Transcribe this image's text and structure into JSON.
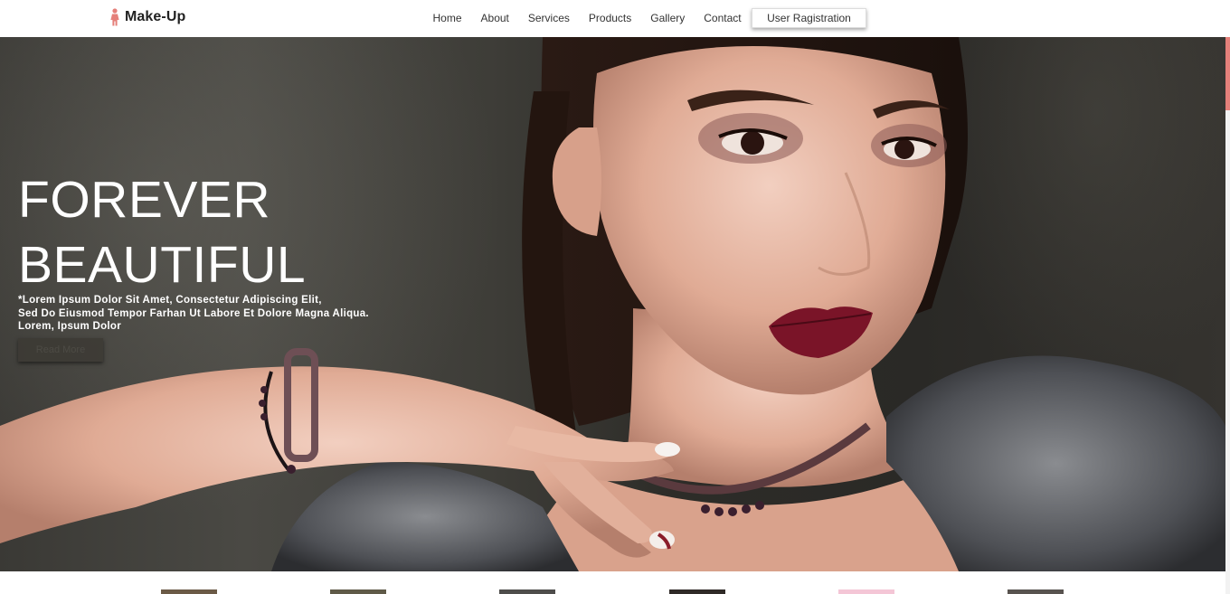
{
  "brand": {
    "name": "Make-Up",
    "icon": "woman-icon",
    "icon_color": "#e5807a"
  },
  "nav": {
    "links": [
      "Home",
      "About",
      "Services",
      "Products",
      "Gallery",
      "Contact"
    ],
    "register_label": "User Ragistration"
  },
  "hero": {
    "title_line1": "FOREVER",
    "title_line2": "BEAUTIFUL",
    "desc_line1": "*Lorem Ipsum Dolor Sit Amet, Consectetur Adipiscing Elit,",
    "desc_line2": "Sed Do Eiusmod Tempor Farhan Ut Labore Et Dolore Magna Aliqua.",
    "desc_line3": "Lorem, Ipsum Dolor",
    "button_label": "Read More",
    "image_subject": "woman with dark red lipstick"
  },
  "colors": {
    "accent": "#e5807a",
    "hero_text": "#ffffff"
  },
  "thumbnails": [
    {
      "color": "#6b5a46"
    },
    {
      "color": "#5f5a48"
    },
    {
      "color": "#4e4d4b"
    },
    {
      "color": "#2f2a27"
    },
    {
      "color": "#f4c6d6"
    },
    {
      "color": "#58534f"
    }
  ]
}
